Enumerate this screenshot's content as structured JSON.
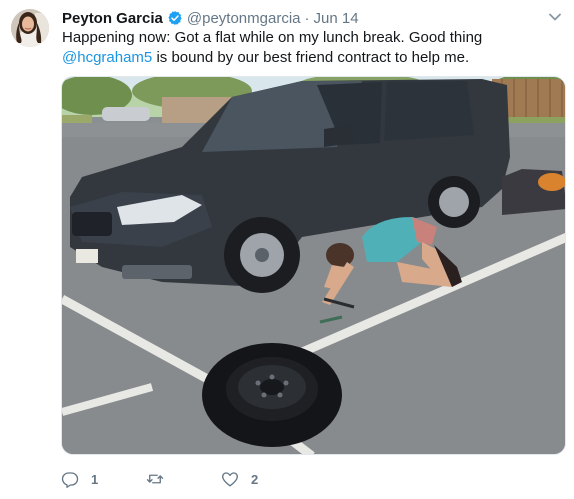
{
  "tweet": {
    "author": {
      "display_name": "Peyton Garcia",
      "handle": "@peytonmgarcia",
      "verified": true,
      "verified_color": "#1da1f2"
    },
    "separator": "·",
    "date": "Jun 14",
    "text_before": "Happening now: Got a flat while on my lunch break. Good thing ",
    "mention": "@hcgraham5",
    "text_after": " is bound by our best friend contract to help me.",
    "actions": {
      "reply_count": "1",
      "retweet_count": "",
      "like_count": "2"
    }
  },
  "icons": {
    "verified": "verified-badge-icon",
    "caret": "chevron-down-icon",
    "reply": "reply-icon",
    "retweet": "retweet-icon",
    "like": "heart-icon"
  },
  "colors": {
    "link": "#1b95e0",
    "secondary_text": "#657786",
    "border": "#e1e8ed"
  }
}
